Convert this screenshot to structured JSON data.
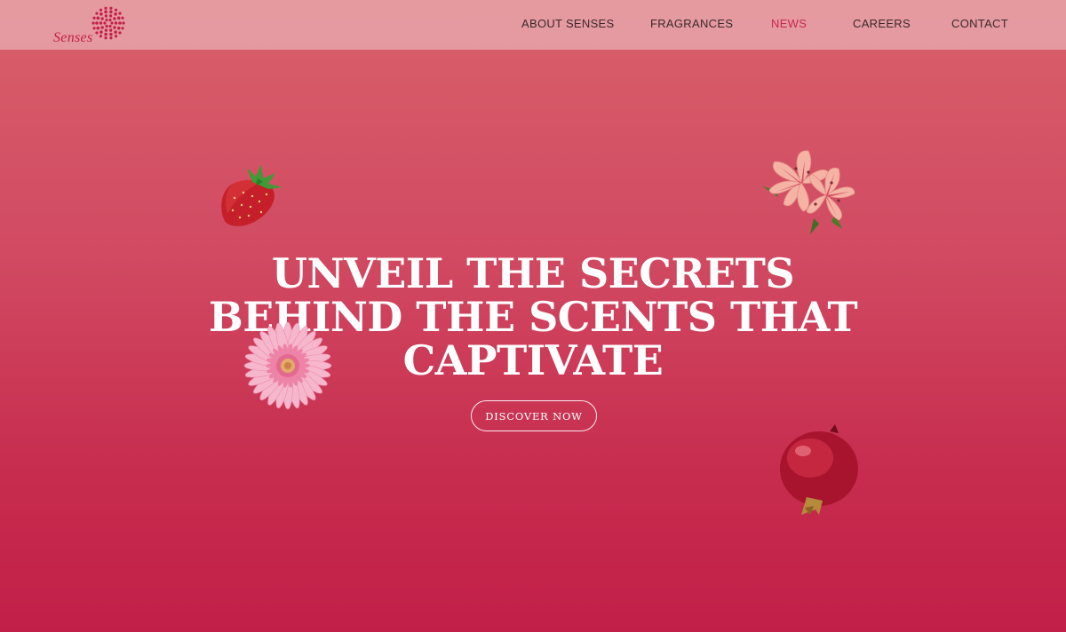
{
  "brand": {
    "name": "Senses",
    "logo_icon": "dotted-sun-icon",
    "color": "#c2204a"
  },
  "nav": {
    "items": [
      {
        "label": "ABOUT SENSES"
      },
      {
        "label": "FRAGRANCES"
      },
      {
        "label": "NEWS",
        "active": true
      },
      {
        "label": "CAREERS"
      },
      {
        "label": "CONTACT"
      }
    ],
    "active_color": "#c8284f"
  },
  "hero": {
    "title_lines": [
      "UNVEIL THE SECRETS",
      "BEHIND THE SCENTS THAT",
      "CAPTIVATE"
    ],
    "cta_label": "DISCOVER NOW"
  },
  "decorations": [
    "strawberry-image",
    "pink-lily-image",
    "pink-gerbera-image",
    "pomegranate-image"
  ],
  "colors": {
    "background_top": "#d9606a",
    "background_bottom": "#c21f48",
    "header_overlay": "#e8aaaf"
  }
}
